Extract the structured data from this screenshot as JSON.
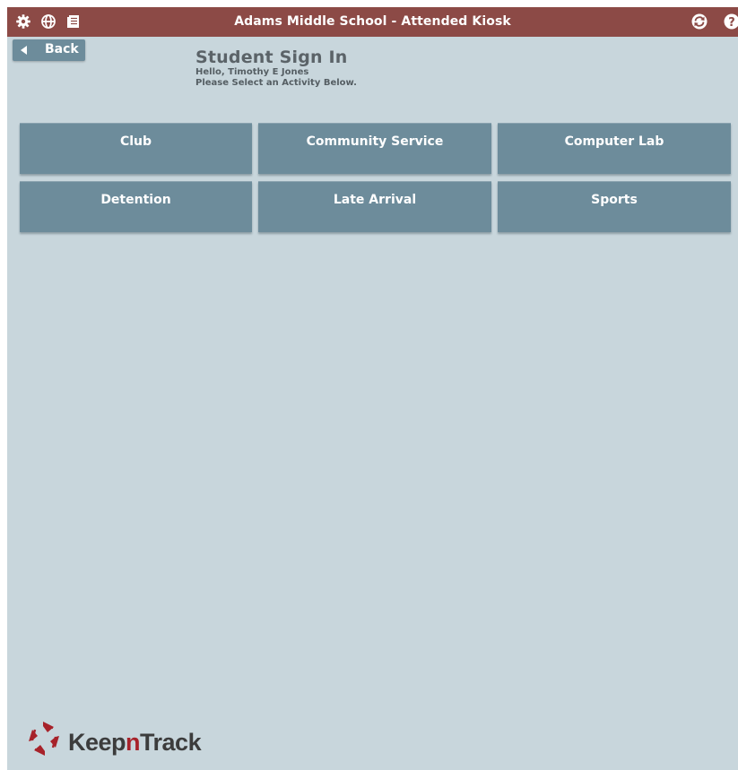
{
  "topbar": {
    "title": "Adams Middle School - Attended Kiosk",
    "left_icons": [
      "gear-icon",
      "globe-icon",
      "document-icon"
    ],
    "right_icons": [
      "refresh-icon",
      "help-icon"
    ],
    "color": "#8c4a46"
  },
  "back": {
    "label": "Back"
  },
  "heading": {
    "title": "Student Sign In",
    "greeting": "Hello, Timothy E Jones",
    "instruction": "Please Select an Activity Below."
  },
  "activities": [
    {
      "label": "Club"
    },
    {
      "label": "Community Service"
    },
    {
      "label": "Computer Lab"
    },
    {
      "label": "Detention"
    },
    {
      "label": "Late Arrival"
    },
    {
      "label": "Sports"
    }
  ],
  "logo": {
    "prefix": "Keep",
    "accent": "n",
    "suffix": "Track"
  },
  "colors": {
    "background": "#c8d6dc",
    "button": "#6d8c9b",
    "accent": "#a7222a"
  }
}
